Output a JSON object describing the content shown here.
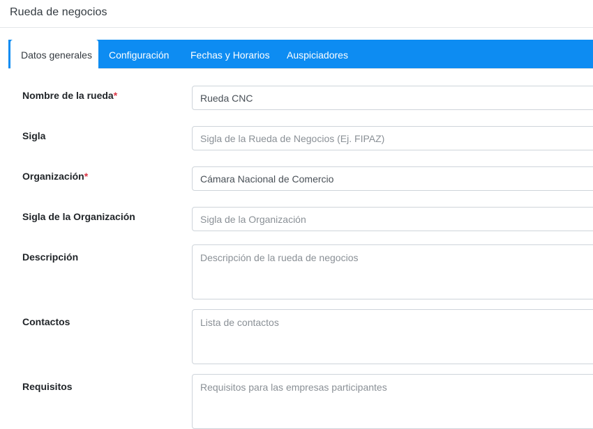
{
  "header": {
    "title": "Rueda de negocios"
  },
  "tabs": [
    {
      "label": "Datos generales",
      "active": true
    },
    {
      "label": "Configuración",
      "active": false
    },
    {
      "label": "Fechas y Horarios",
      "active": false
    },
    {
      "label": "Auspiciadores",
      "active": false
    }
  ],
  "form": {
    "nombre": {
      "label": "Nombre de la rueda",
      "required_mark": "*",
      "value": "Rueda CNC",
      "placeholder": ""
    },
    "sigla": {
      "label": "Sigla",
      "value": "",
      "placeholder": "Sigla de la Rueda de Negocios (Ej. FIPAZ)"
    },
    "organizacion": {
      "label": "Organización",
      "required_mark": "*",
      "value": "Cámara Nacional de Comercio",
      "placeholder": ""
    },
    "sigla_org": {
      "label": "Sigla de la Organización",
      "value": "",
      "placeholder": "Sigla de la Organización"
    },
    "descripcion": {
      "label": "Descripción",
      "value": "",
      "placeholder": "Descripción de la rueda de negocios"
    },
    "contactos": {
      "label": "Contactos",
      "value": "",
      "placeholder": "Lista de contactos"
    },
    "requisitos": {
      "label": "Requisitos",
      "value": "",
      "placeholder": "Requisitos para las empresas participantes"
    }
  },
  "colors": {
    "tab_bar": "#0d8cf2",
    "required": "#dc3545",
    "border": "#ced4da"
  }
}
